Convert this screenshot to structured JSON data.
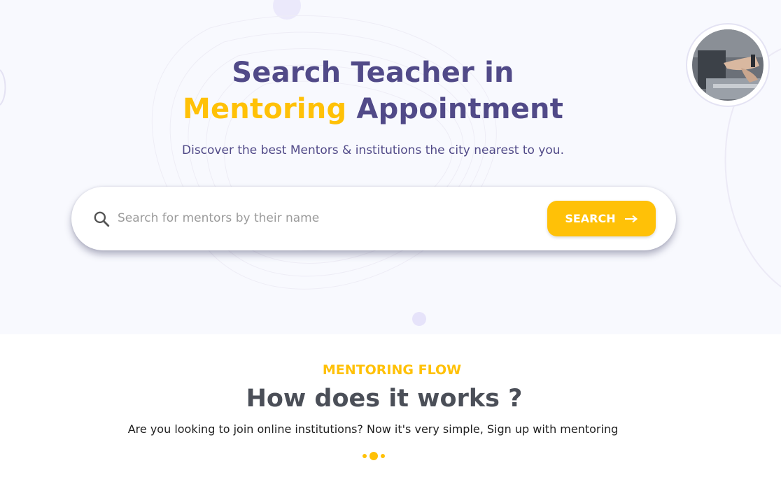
{
  "hero": {
    "title_line1": "Search Teacher in",
    "title_highlight": "Mentoring",
    "title_rest": " Appointment",
    "subtitle": "Discover the best Mentors & institutions the city nearest to you."
  },
  "search": {
    "placeholder": "Search for mentors by their name",
    "value": "",
    "button_label": "SEARCH",
    "icon": "search-icon",
    "button_icon": "arrow-right-icon"
  },
  "flow": {
    "eyebrow": "MENTORING FLOW",
    "title": "How does it works ?",
    "description": "Are you looking to join online institutions? Now it's very simple, Sign up with mentoring"
  },
  "colors": {
    "primary": "#514a88",
    "accent": "#ffc107",
    "hero_bg": "#f8f9fe",
    "heading_dark": "#4b4f58"
  }
}
